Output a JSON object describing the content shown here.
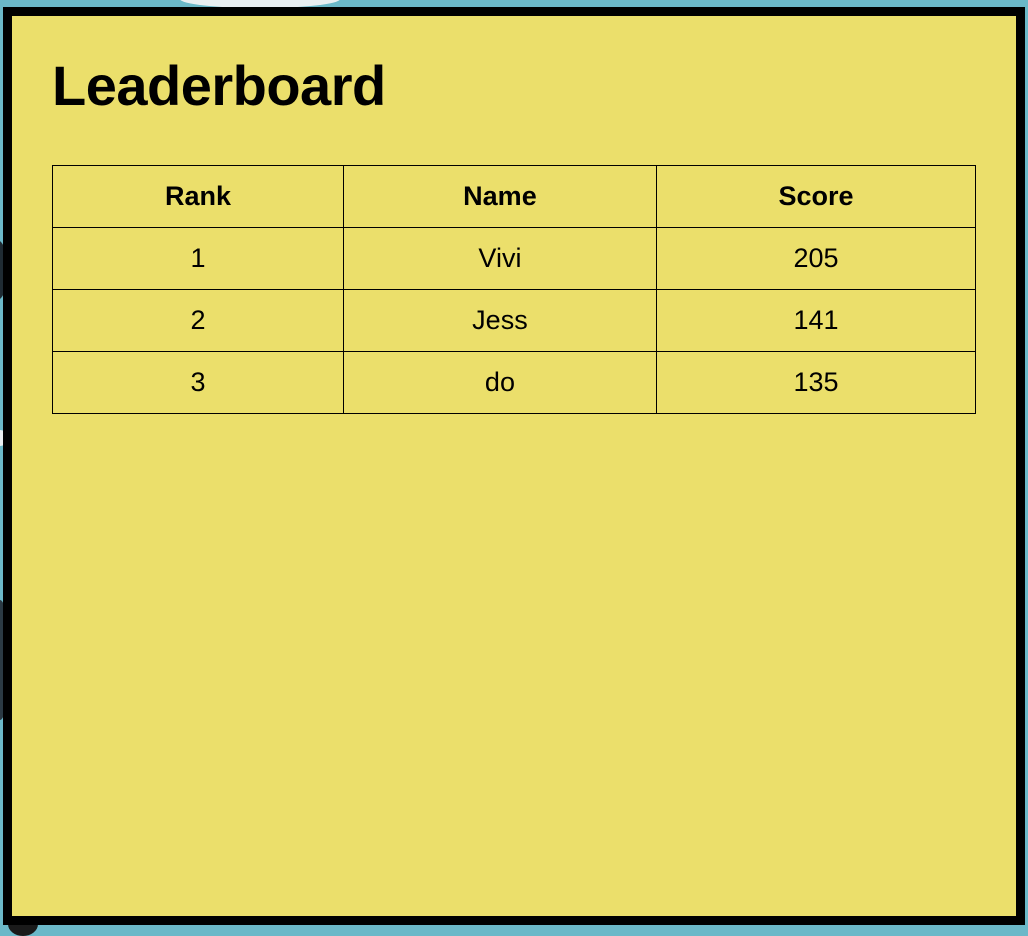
{
  "leaderboard": {
    "title": "Leaderboard",
    "columns": [
      "Rank",
      "Name",
      "Score"
    ],
    "rows": [
      {
        "rank": "1",
        "name": "Vivi",
        "score": "205"
      },
      {
        "rank": "2",
        "name": "Jess",
        "score": "141"
      },
      {
        "rank": "3",
        "name": "do",
        "score": "135"
      }
    ]
  },
  "colors": {
    "panel_background": "#ebdf6b",
    "panel_border": "#000000",
    "page_background": "#6bb8c8"
  }
}
